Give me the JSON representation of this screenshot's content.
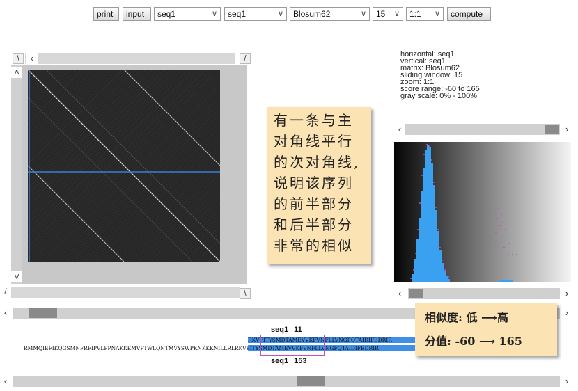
{
  "toolbar": {
    "print_label": "print",
    "input_label": "input",
    "seq_h": "seq1",
    "seq_v": "seq1",
    "matrix": "Blosum62",
    "window": "15",
    "zoom": "1:1",
    "compute_label": "compute"
  },
  "info": {
    "horizontal": "horizontal: seq1",
    "vertical": "vertical: seq1",
    "matrix": "matrix: Blosum62",
    "window": "sliding window: 15",
    "zoom": "zoom: 1:1",
    "score_range": "score range: -60 to 165",
    "gray_scale": "gray scale: 0% - 100%"
  },
  "annotation": {
    "lines": [
      "有一条与主",
      "对角线平行",
      "的次对角线,",
      "说明该序列",
      "的前半部分",
      "和后半部分",
      "非常的相似"
    ]
  },
  "legend": {
    "similarity": "相似度: 低 ⟶高",
    "score": "分值: -60 ⟶ 165"
  },
  "alignment": {
    "top_label": "seq1",
    "top_pos": "11",
    "top_seq": "RKVFITYSMDTAMEVVKFVNFLLVNGFQTAIDIFEDRIR",
    "bottom_full_seq": "RMMQIEFIKQGSMNFRFIPVLFPNAKKEMVPTWLQNTMVYSWPKNKKKNILLRLRKVFITYSMDTAMEVVKFVNFLLVNGFQTAIDIFEDRIR",
    "bottom_label": "seq1",
    "bottom_pos": "153"
  },
  "colors": {
    "highlight": "#3f8ee8",
    "window_box": "#c050c0",
    "crosshair": "#3a7fd5",
    "note_bg": "#fbe3b3"
  },
  "icons": {
    "left": "chevron-left-icon",
    "right": "chevron-right-icon",
    "up": "chevron-up-icon",
    "down": "chevron-down-icon"
  },
  "histogram_state": {
    "score_min": -60,
    "score_max": 165
  }
}
